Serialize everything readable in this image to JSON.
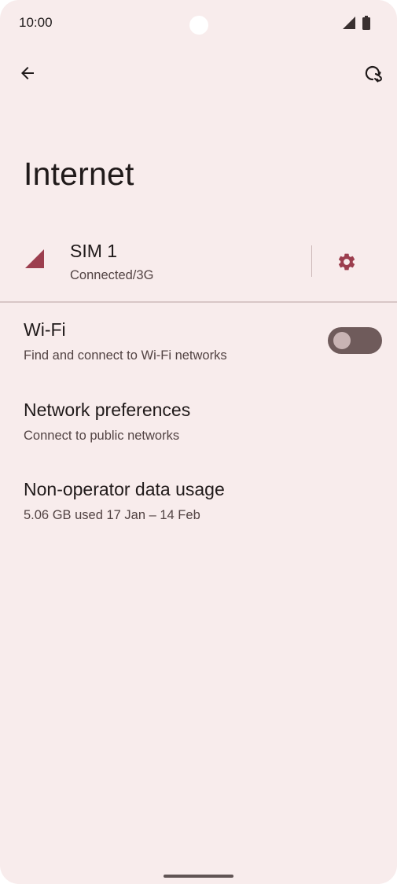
{
  "status_bar": {
    "time": "10:00"
  },
  "top_bar": {
    "back_icon": "arrow-back-icon",
    "help_icon": "network-reset-icon"
  },
  "page": {
    "title": "Internet"
  },
  "sim": {
    "name": "SIM 1",
    "status": "Connected/3G",
    "signal_icon": "cellular-signal-icon",
    "settings_icon": "gear-icon"
  },
  "wifi": {
    "title": "Wi-Fi",
    "summary": "Find and connect to Wi-Fi networks",
    "enabled": false
  },
  "network_preferences": {
    "title": "Network preferences",
    "summary": "Connect to public networks"
  },
  "non_operator_data_usage": {
    "title": "Non-operator data usage",
    "summary": "5.06 GB used 17 Jan – 14 Feb"
  },
  "colors": {
    "background": "#f8ecec",
    "accent": "#9c3e4e",
    "toggle_track_off": "#6f5b5b",
    "text_primary": "#201a1a",
    "text_secondary": "#524343"
  }
}
